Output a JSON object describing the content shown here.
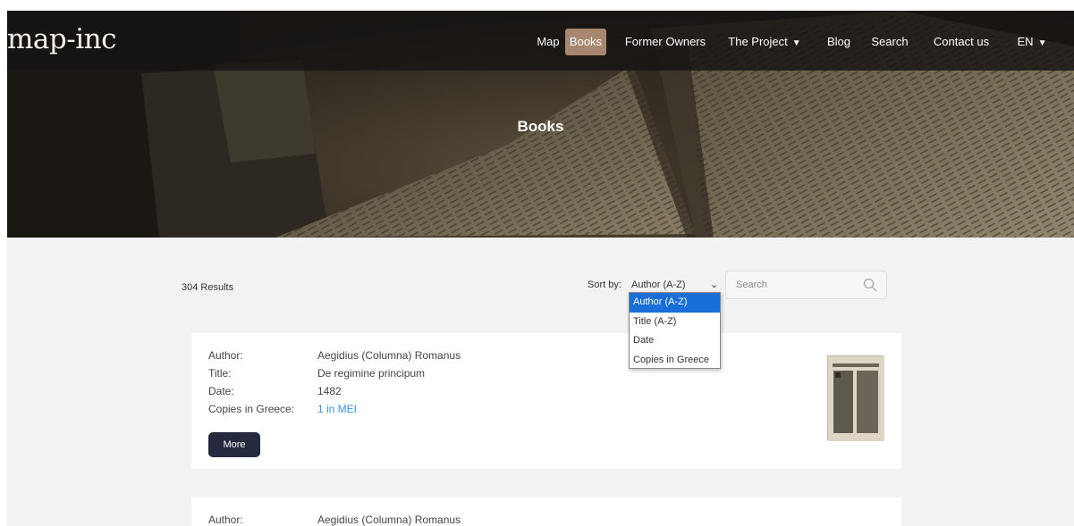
{
  "header": {
    "logo": "map-inc",
    "nav": [
      {
        "label": "Map",
        "active": false
      },
      {
        "label": "Books",
        "active": true
      },
      {
        "label": "Former Owners",
        "active": false
      },
      {
        "label": "The Project",
        "active": false,
        "caret": "▼"
      },
      {
        "label": "Blog",
        "active": false
      },
      {
        "label": "Search",
        "active": false
      },
      {
        "label": "Contact us",
        "active": false
      },
      {
        "label": "EN",
        "active": false,
        "caret": "▼"
      }
    ]
  },
  "hero": {
    "title": "Books"
  },
  "results": {
    "count_text": "304 Results",
    "sort_label": "Sort by:",
    "sort_value": "Author (A-Z)",
    "sort_options": [
      "Author (A-Z)",
      "Title (A-Z)",
      "Date",
      "Copies in Greece"
    ],
    "search_placeholder": "Search"
  },
  "labels": {
    "author": "Author:",
    "title": "Title:",
    "date": "Date:",
    "copies": "Copies in Greece:",
    "more": "More"
  },
  "books": [
    {
      "author": "Aegidius (Columna) Romanus",
      "title": "De regimine principum",
      "date": "1482",
      "copies": "1 in MEI"
    },
    {
      "author": "Aegidius (Columna) Romanus"
    }
  ],
  "colors": {
    "accent": "#a88770",
    "button": "#252a3e",
    "link": "#3b8fd9",
    "selected_option": "#1a6ed8"
  }
}
